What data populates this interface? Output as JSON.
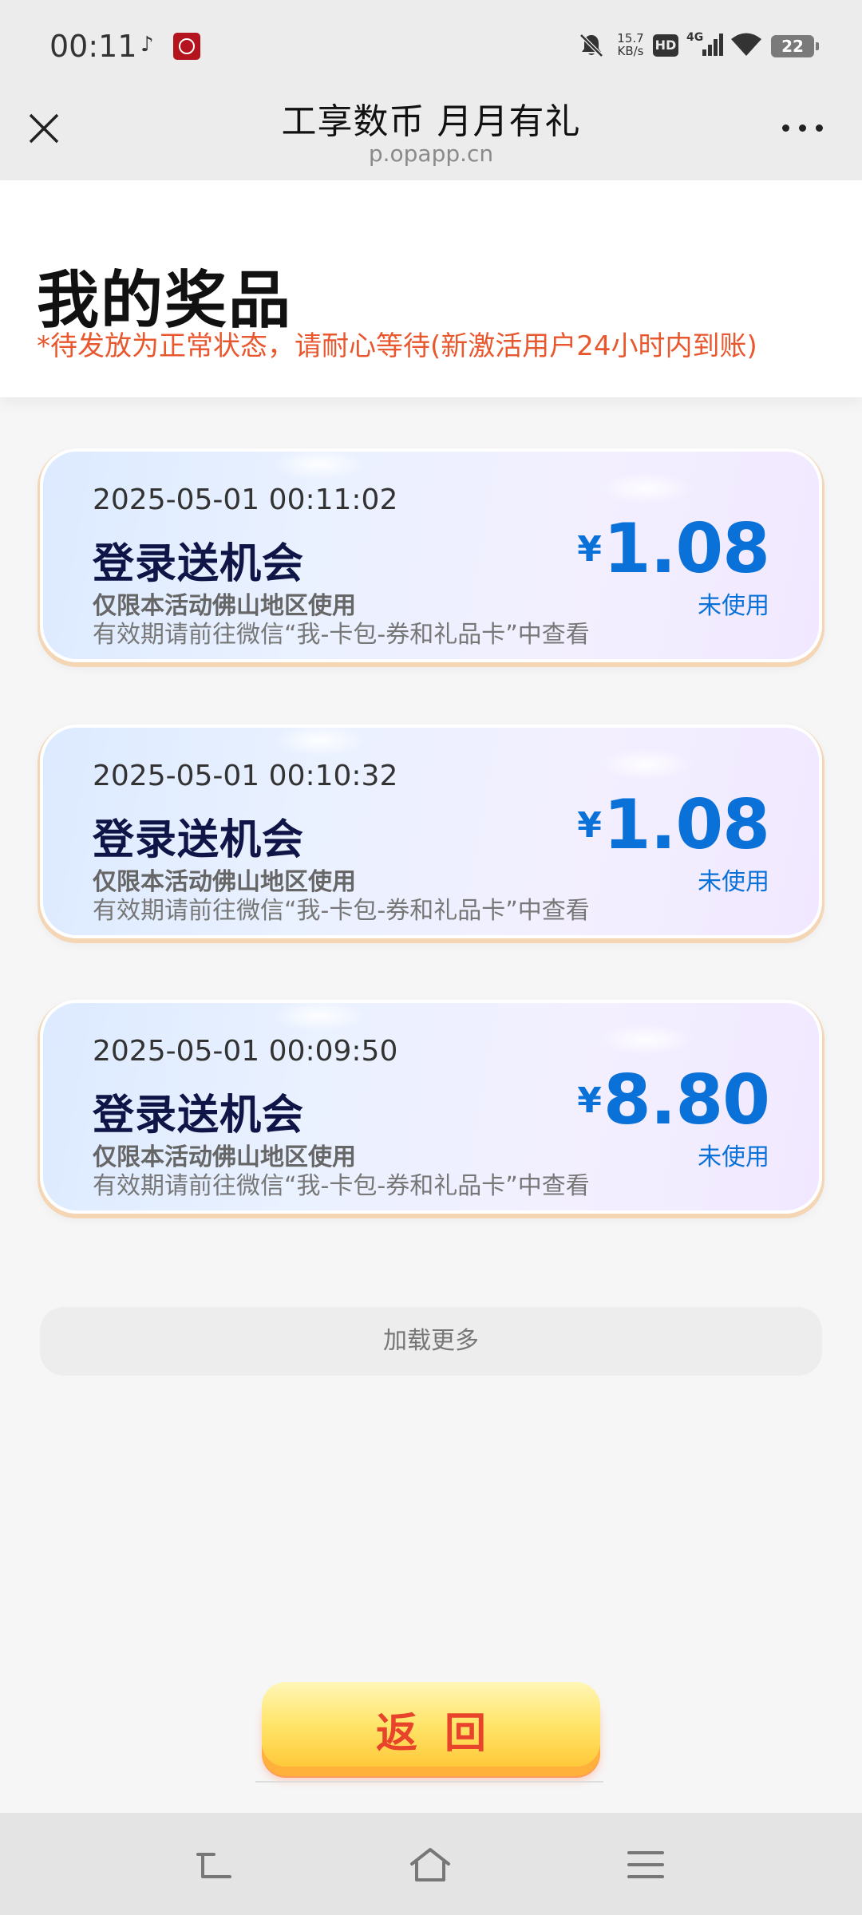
{
  "status_bar": {
    "time": "00:11",
    "net_speed_value": "15.7",
    "net_speed_unit": "KB/s",
    "hd_label": "HD",
    "network": "4G",
    "battery": "22",
    "icons": [
      "tiktok-icon",
      "bank-app-icon",
      "mute-icon",
      "signal-icon",
      "wifi-icon",
      "battery-icon"
    ]
  },
  "title_bar": {
    "title": "工享数币  月月有礼",
    "url": "p.opapp.cn"
  },
  "header": {
    "heading": "我的奖品",
    "notice": "*待发放为正常状态，请耐心等待(新激活用户24小时内到账)"
  },
  "prizes": [
    {
      "date": "2025-05-01 00:11:02",
      "name": "登录送机会",
      "region": "仅限本活动佛山地区使用",
      "expiry": "有效期请前往微信“我-卡包-券和礼品卡”中查看",
      "currency": "¥",
      "amount": "1.08",
      "status": "未使用"
    },
    {
      "date": "2025-05-01 00:10:32",
      "name": "登录送机会",
      "region": "仅限本活动佛山地区使用",
      "expiry": "有效期请前往微信“我-卡包-券和礼品卡”中查看",
      "currency": "¥",
      "amount": "1.08",
      "status": "未使用"
    },
    {
      "date": "2025-05-01 00:09:50",
      "name": "登录送机会",
      "region": "仅限本活动佛山地区使用",
      "expiry": "有效期请前往微信“我-卡包-券和礼品卡”中查看",
      "currency": "¥",
      "amount": "8.80",
      "status": "未使用"
    }
  ],
  "load_more": "加载更多",
  "back_button": "返回",
  "colors": {
    "accent_blue": "#0a71d8",
    "notice_orange": "#e8572e",
    "button_red": "#e8442c"
  }
}
